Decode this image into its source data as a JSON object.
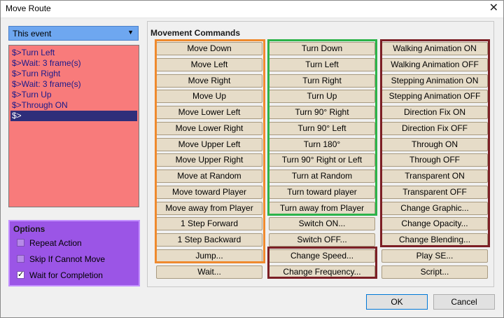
{
  "window": {
    "title": "Move Route",
    "close_glyph": "✕"
  },
  "target": {
    "selected": "This event"
  },
  "event_list": [
    "$>Turn Left",
    "$>Wait: 3 frame(s)",
    "$>Turn Right",
    "$>Wait: 3 frame(s)",
    "$>Turn Up",
    "$>Through ON",
    "$>"
  ],
  "options": {
    "title": "Options",
    "items": [
      {
        "label": "Repeat Action",
        "checked": false
      },
      {
        "label": "Skip If Cannot Move",
        "checked": false
      },
      {
        "label": "Wait for Completion",
        "checked": true
      }
    ]
  },
  "commands": {
    "title": "Movement Commands",
    "col1": [
      "Move Down",
      "Move Left",
      "Move Right",
      "Move Up",
      "Move Lower Left",
      "Move Lower Right",
      "Move Upper Left",
      "Move Upper Right",
      "Move at Random",
      "Move toward Player",
      "Move away from Player",
      "1 Step Forward",
      "1 Step Backward",
      "Jump...",
      "Wait..."
    ],
    "col2": [
      "Turn Down",
      "Turn Left",
      "Turn Right",
      "Turn Up",
      "Turn 90° Right",
      "Turn 90° Left",
      "Turn 180°",
      "Turn 90° Right or Left",
      "Turn at Random",
      "Turn toward player",
      "Turn away from Player",
      "Switch ON...",
      "Switch OFF...",
      "Change Speed...",
      "Change Frequency..."
    ],
    "col3": [
      "Walking Animation ON",
      "Walking Animation OFF",
      "Stepping Animation ON",
      "Stepping Animation OFF",
      "Direction Fix ON",
      "Direction Fix OFF",
      "Through ON",
      "Through OFF",
      "Transparent ON",
      "Transparent OFF",
      "Change Graphic...",
      "Change Opacity...",
      "Change Blending...",
      "Play SE...",
      "Script..."
    ]
  },
  "footer": {
    "ok": "OK",
    "cancel": "Cancel"
  },
  "colors": {
    "event_list_bg": "#f87b7b",
    "options_bg": "#9b55e6",
    "dropdown_bg": "#6ea7f0",
    "frame_orange": "#ef8a2e",
    "frame_green": "#2db34a",
    "frame_red": "#7c1f25",
    "button_bg": "#e6dcc8"
  }
}
